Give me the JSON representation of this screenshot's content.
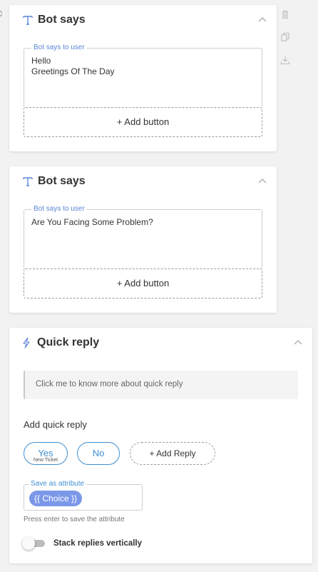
{
  "cards": [
    {
      "title": "Bot says",
      "field_label": "Bot says to user",
      "lines": [
        "Hello",
        "Greetings Of The Day"
      ],
      "add_button": "+ Add button"
    },
    {
      "title": "Bot says",
      "field_label": "Bot says to user",
      "lines": [
        "Are You Facing Some Problem?"
      ],
      "add_button": "+ Add button"
    }
  ],
  "quick_reply": {
    "title": "Quick reply",
    "info_text": "Click me to know more about quick reply",
    "section_label": "Add quick reply",
    "replies": [
      {
        "label": "Yes",
        "sub": "New Ticket"
      },
      {
        "label": "No",
        "sub": ""
      }
    ],
    "add_reply": "+ Add Reply",
    "attribute_label": "Save as attribute",
    "attribute_value": "{{ Choice }}",
    "hint": "Press enter to save the attribute",
    "toggle_label": "Stack replies vertically",
    "toggle_on": false
  },
  "side_toolbar": [
    "trash-icon",
    "duplicate-icon",
    "download-icon"
  ],
  "colors": {
    "accent": "#3f8fd2",
    "chip": "#7b98e8",
    "legend": "#5a86d6"
  }
}
